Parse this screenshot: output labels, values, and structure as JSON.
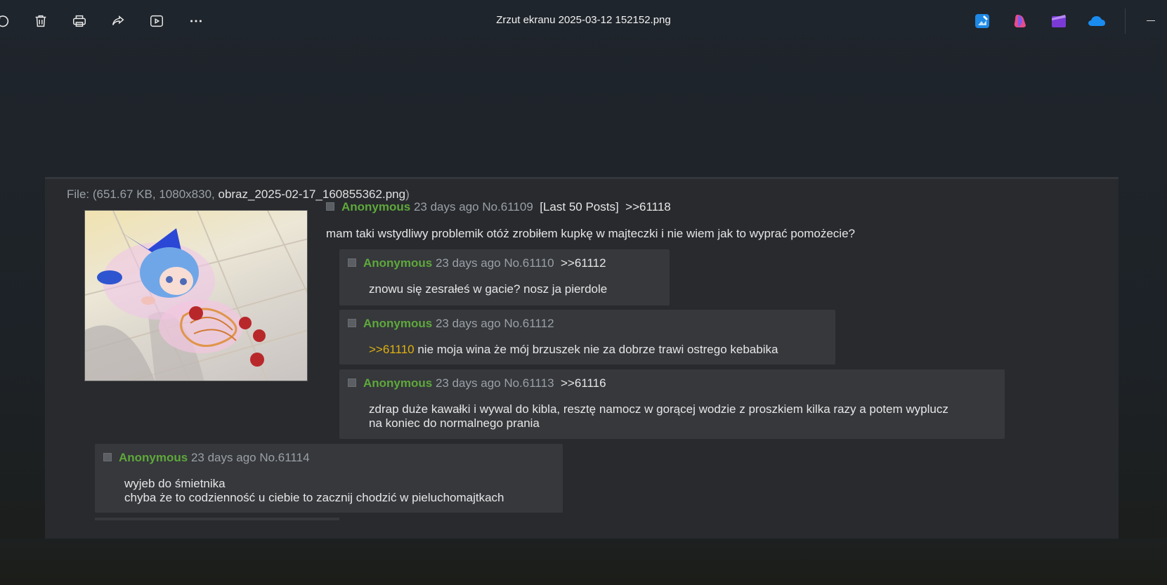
{
  "window": {
    "title": "Zrzut ekranu 2025-03-12 152152.png",
    "toolbar": {
      "icons": [
        "rotate-icon",
        "delete-icon",
        "print-icon",
        "share-icon",
        "slideshow-icon",
        "more-icon"
      ],
      "apps": [
        "photo-editor-icon",
        "copilot-icon",
        "clipchamp-icon",
        "onedrive-icon"
      ],
      "minimize_label": "—"
    }
  },
  "post": {
    "file_prefix": "File: (651.67 KB, 1080x830, ",
    "file_name": "obraz_2025-02-17_160855362.png",
    "file_suffix": ")",
    "op": {
      "name": "Anonymous",
      "meta": "23 days ago No.61109",
      "last50": "[Last 50 Posts]",
      "backlink": ">>61118",
      "text": "mam taki wstydliwy problemik otóż zrobiłem kupkę w majteczki i nie wiem jak to wyprać pomożecie?"
    },
    "replies": [
      {
        "name": "Anonymous",
        "meta": "23 days ago No.61110",
        "backlink": ">>61112",
        "quote": "",
        "lines": [
          "znowu się zesrałeś w gacie? nosz ja pierdole"
        ]
      },
      {
        "name": "Anonymous",
        "meta": "23 days ago No.61112",
        "backlink": "",
        "quote": ">>61110",
        "lines": [
          " nie moja wina że mój brzuszek nie za dobrze trawi ostrego kebabika"
        ]
      },
      {
        "name": "Anonymous",
        "meta": "23 days ago No.61113",
        "backlink": ">>61116",
        "quote": "",
        "lines": [
          "zdrap duże kawałki i wywal do kibla, resztę namocz w gorącej wodzie z proszkiem kilka razy a potem wyplucz",
          "na koniec do normalnego prania"
        ]
      },
      {
        "name": "Anonymous",
        "meta": "23 days ago No.61114",
        "backlink": "",
        "quote": "",
        "lines": [
          "wyjeb do śmietnika",
          "chyba że to codzienność u ciebie to zacznij chodzić w pieluchomajtkach"
        ]
      }
    ]
  }
}
